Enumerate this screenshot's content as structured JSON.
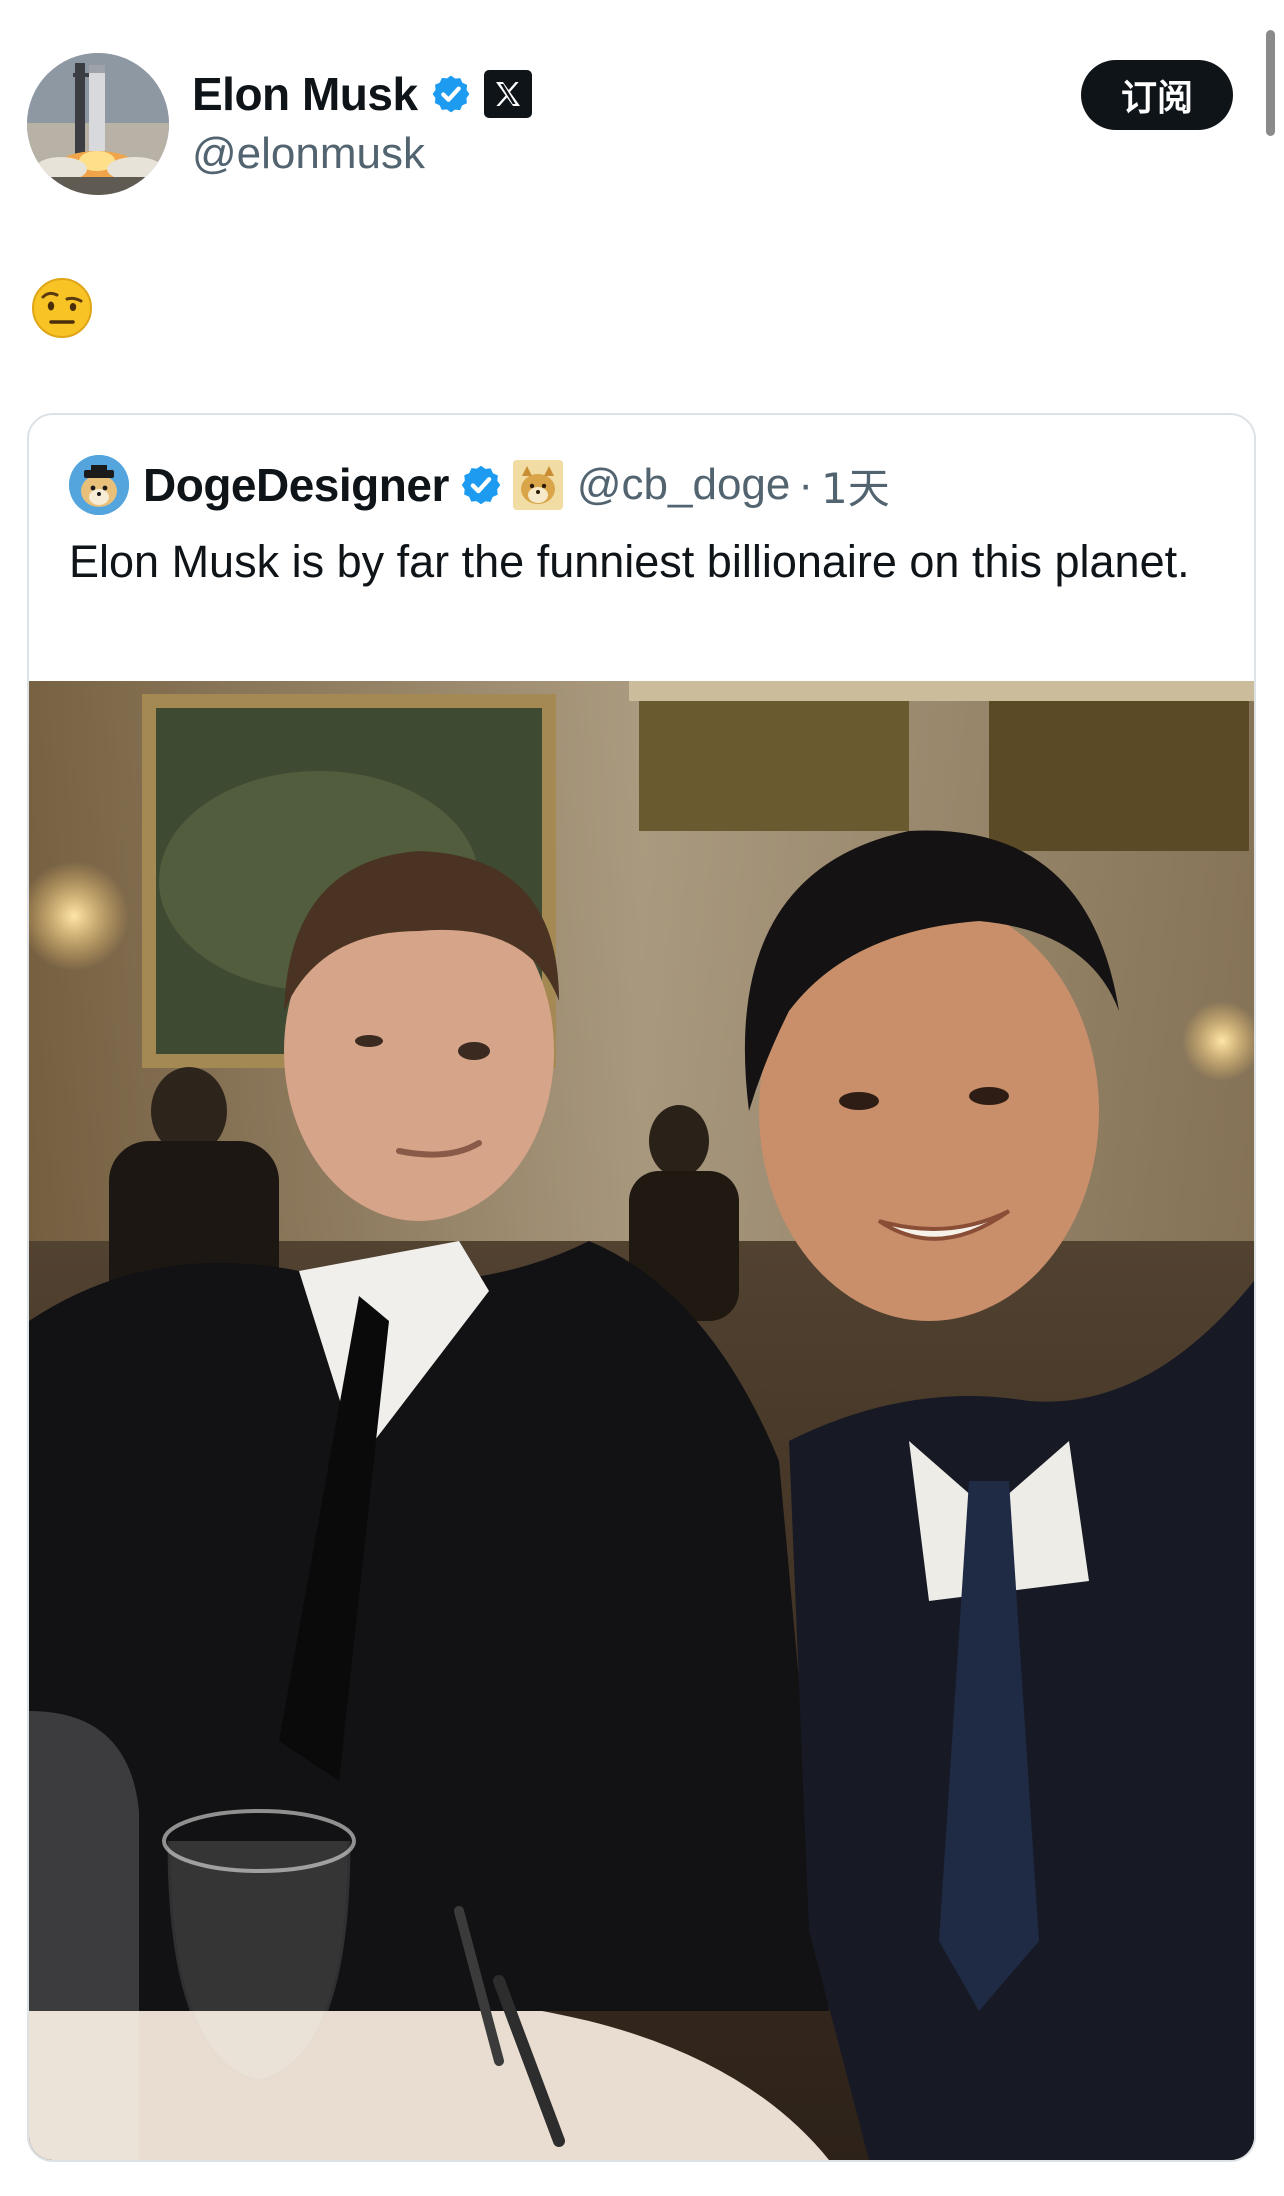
{
  "author": {
    "display_name": "Elon Musk",
    "handle": "@elonmusk",
    "avatar_icon": "rocket-launch-avatar",
    "verified_icon": "verified-badge-icon",
    "affiliate_icon": "x-logo-icon"
  },
  "header": {
    "subscribe_label": "订阅"
  },
  "tweet": {
    "emoji": "🤨",
    "emoji_icon": "raised-eyebrow-face-icon"
  },
  "quoted_tweet": {
    "display_name": "DogeDesigner",
    "handle": "@cb_doge",
    "separator": "·",
    "time": "1天",
    "text": "Elon Musk is by far the funniest billionaire on this planet.",
    "avatar_icon": "doge-avatar",
    "affiliate_icon": "doge-badge-icon",
    "photo_icon": "two-men-selfie-photo"
  },
  "colors": {
    "text_primary": "#0f1419",
    "text_secondary": "#536471",
    "verified_blue": "#1d9bf0",
    "card_border": "#dde2e6",
    "button_bg": "#0f1419"
  }
}
